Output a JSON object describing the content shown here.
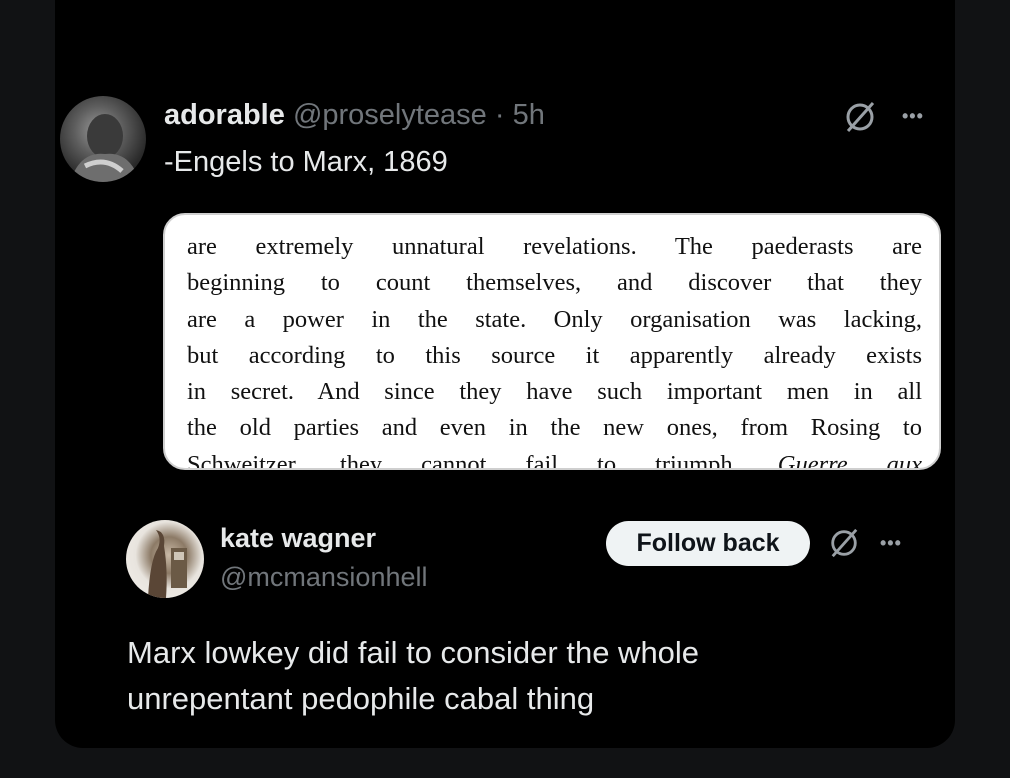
{
  "post": {
    "display_name": "adorable",
    "handle": "@proselytease",
    "separator": "·",
    "time": "5h",
    "text": "-Engels to Marx, 1869",
    "quote_lines": [
      "are extremely unnatural revelations. The paederasts are",
      "beginning to count themselves, and discover that they",
      "are a power in the state. Only organisation was lacking,",
      "but according to this source it apparently already exists",
      "in secret. And since they have such important men in all",
      "the old parties and even in the new ones, from Rosing to"
    ],
    "quote_last_plain": "Schweitzer, they cannot fail to triumph. ",
    "quote_last_italic": "Guerre aux"
  },
  "reply": {
    "display_name": "kate wagner",
    "handle": "@mcmansionhell",
    "follow_label": "Follow back",
    "text_line1": "Marx lowkey did fail to consider the whole",
    "text_line2": "unrepentant pedophile cabal thing"
  },
  "icons": {
    "grok": "slashed-circle-icon",
    "more": "more-dots-icon"
  },
  "colors": {
    "background": "#000000",
    "text": "#e7e9ea",
    "muted": "#71767b",
    "button_bg": "#eff3f4"
  }
}
